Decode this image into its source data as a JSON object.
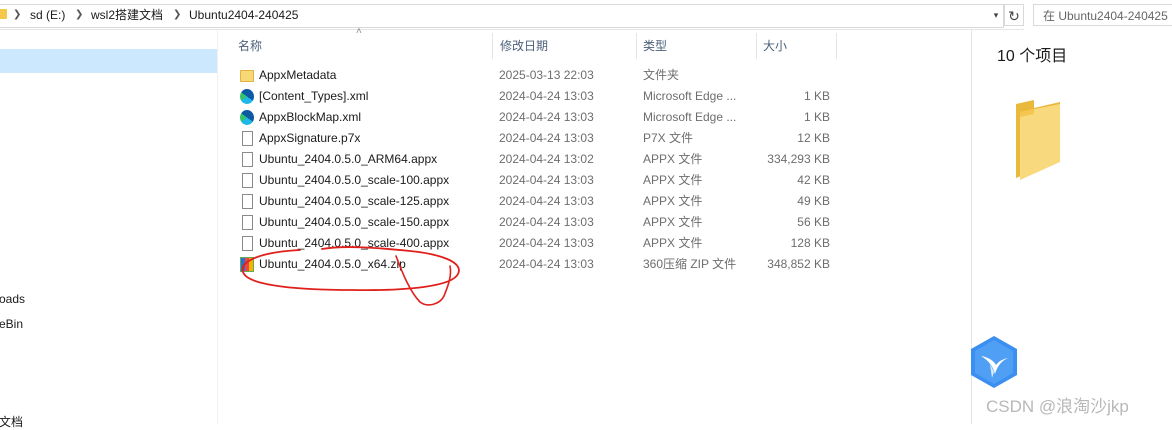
{
  "address_bar": {
    "crumbs": [
      "sd (E:)",
      "wsl2搭建文档",
      "Ubuntu2404-240425"
    ],
    "search_placeholder": "在 Ubuntu2404-240425"
  },
  "nav_pane": {
    "items": [
      "oads",
      "eBin",
      "文档"
    ]
  },
  "columns": {
    "name": "名称",
    "date": "修改日期",
    "type": "类型",
    "size": "大小"
  },
  "files": [
    {
      "name": "AppxMetadata",
      "date": "2025-03-13 22:03",
      "type": "文件夹",
      "size": "",
      "icon": "folder-icon"
    },
    {
      "name": "[Content_Types].xml",
      "date": "2024-04-24 13:03",
      "type": "Microsoft Edge ...",
      "size": "1 KB",
      "icon": "edge-icon"
    },
    {
      "name": "AppxBlockMap.xml",
      "date": "2024-04-24 13:03",
      "type": "Microsoft Edge ...",
      "size": "1 KB",
      "icon": "edge-icon"
    },
    {
      "name": "AppxSignature.p7x",
      "date": "2024-04-24 13:03",
      "type": "P7X 文件",
      "size": "12 KB",
      "icon": "file-icon"
    },
    {
      "name": "Ubuntu_2404.0.5.0_ARM64.appx",
      "date": "2024-04-24 13:02",
      "type": "APPX 文件",
      "size": "334,293 KB",
      "icon": "file-icon"
    },
    {
      "name": "Ubuntu_2404.0.5.0_scale-100.appx",
      "date": "2024-04-24 13:03",
      "type": "APPX 文件",
      "size": "42 KB",
      "icon": "file-icon"
    },
    {
      "name": "Ubuntu_2404.0.5.0_scale-125.appx",
      "date": "2024-04-24 13:03",
      "type": "APPX 文件",
      "size": "49 KB",
      "icon": "file-icon"
    },
    {
      "name": "Ubuntu_2404.0.5.0_scale-150.appx",
      "date": "2024-04-24 13:03",
      "type": "APPX 文件",
      "size": "56 KB",
      "icon": "file-icon"
    },
    {
      "name": "Ubuntu_2404.0.5.0_scale-400.appx",
      "date": "2024-04-24 13:03",
      "type": "APPX 文件",
      "size": "128 KB",
      "icon": "file-icon"
    },
    {
      "name": "Ubuntu_2404.0.5.0_x64.zip",
      "date": "2024-04-24 13:03",
      "type": "360压缩 ZIP 文件",
      "size": "348,852 KB",
      "icon": "zip-icon"
    }
  ],
  "details_pane": {
    "item_count": "10 个项目"
  },
  "watermark": "CSDN @浪淘沙jkp",
  "colors": {
    "selection": "#cce8ff",
    "header_text": "#4c607a",
    "annotation": "#e0201c",
    "folder": "#f8d775"
  }
}
